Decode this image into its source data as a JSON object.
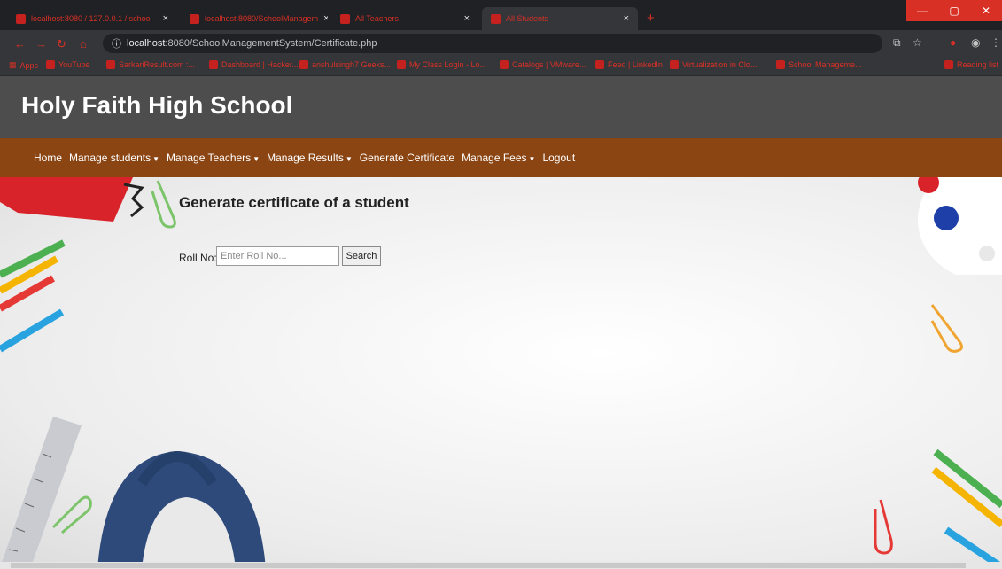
{
  "browser": {
    "tabs": [
      {
        "title": "localhost:8080 / 127.0.0.1 / schoo"
      },
      {
        "title": "localhost:8080/SchoolManagem"
      },
      {
        "title": "All Teachers"
      },
      {
        "title": "All Students"
      }
    ],
    "url_host": "localhost",
    "url_rest": ":8080/SchoolManagementSystem/Certificate.php",
    "bookmarks": [
      "Apps",
      "YouTube",
      "SarkariResult.com :...",
      "Dashboard | Hacker...",
      "anshulsingh7 Geeks...",
      "My Class Login - Lo...",
      "Catalogs | VMware...",
      "Feed | LinkedIn",
      "Virtualization in Clo...",
      "School Manageme...",
      "Reading list"
    ]
  },
  "site": {
    "title": "Holy Faith High School",
    "menu": [
      {
        "label": "Home",
        "dropdown": false
      },
      {
        "label": "Manage students",
        "dropdown": true
      },
      {
        "label": "Manage Teachers",
        "dropdown": true
      },
      {
        "label": "Manage Results",
        "dropdown": true
      },
      {
        "label": "Generate Certificate",
        "dropdown": false
      },
      {
        "label": "Manage Fees",
        "dropdown": true
      },
      {
        "label": "Logout",
        "dropdown": false
      }
    ]
  },
  "form": {
    "heading": "Generate certificate of a student",
    "roll_label": "Roll No:",
    "roll_placeholder": "Enter Roll No...",
    "search_label": "Search"
  },
  "colors": {
    "header_bg": "#4d4d4d",
    "menu_bg": "#8b4513",
    "accent_red": "#d93025"
  }
}
